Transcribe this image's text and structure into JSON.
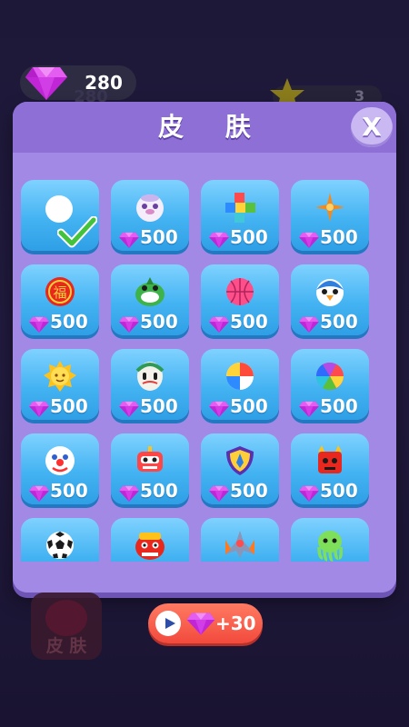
{
  "currency": {
    "gems": "280",
    "ghost_value": "280"
  },
  "level": {
    "number": "3"
  },
  "modal": {
    "title": "皮 肤",
    "close_label": "X"
  },
  "skins": [
    {
      "icon": "white-ball-icon",
      "price": "",
      "owned": true,
      "selected": true
    },
    {
      "icon": "seal-face-icon",
      "price": "500",
      "owned": false
    },
    {
      "icon": "color-blocks-icon",
      "price": "500",
      "owned": false
    },
    {
      "icon": "shuriken-icon",
      "price": "500",
      "owned": false
    },
    {
      "icon": "fu-lucky-icon",
      "price": "500",
      "owned": false
    },
    {
      "icon": "green-monster-icon",
      "price": "500",
      "owned": false
    },
    {
      "icon": "basketball-icon",
      "price": "500",
      "owned": false
    },
    {
      "icon": "penguin-face-icon",
      "price": "500",
      "owned": false
    },
    {
      "icon": "sun-face-icon",
      "price": "500",
      "owned": false
    },
    {
      "icon": "mask-face-icon",
      "price": "500",
      "owned": false
    },
    {
      "icon": "beach-ball-icon",
      "price": "500",
      "owned": false
    },
    {
      "icon": "rainbow-wheel-icon",
      "price": "500",
      "owned": false
    },
    {
      "icon": "clown-face-icon",
      "price": "500",
      "owned": false
    },
    {
      "icon": "robot-face-icon",
      "price": "500",
      "owned": false
    },
    {
      "icon": "shield-badge-icon",
      "price": "500",
      "owned": false
    },
    {
      "icon": "red-devil-icon",
      "price": "500",
      "owned": false
    },
    {
      "icon": "soccer-ball-icon",
      "price": "",
      "owned": false
    },
    {
      "icon": "lion-dance-icon",
      "price": "",
      "owned": false
    },
    {
      "icon": "spaceship-icon",
      "price": "",
      "owned": false
    },
    {
      "icon": "octopus-icon",
      "price": "",
      "owned": false
    }
  ],
  "background_button": {
    "label": "皮 肤"
  },
  "ad_button": {
    "reward": "+30"
  },
  "colors": {
    "modal_bg": "#a389e6",
    "tile_blue": "#44b3f2",
    "gem_purple": "#c025d6",
    "ad_red": "#f24a3c"
  }
}
